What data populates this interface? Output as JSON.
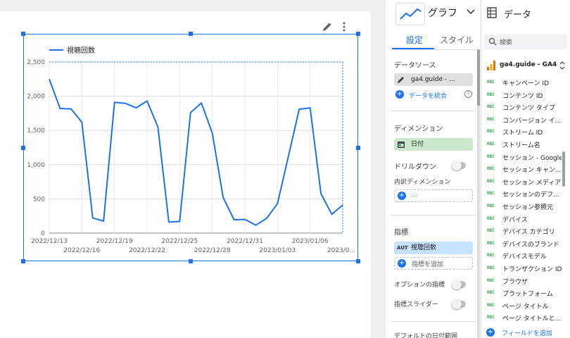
{
  "chart": {
    "legend": "視聴回数",
    "series_color": "#1a73e8"
  },
  "chart_data": {
    "type": "line",
    "series": [
      {
        "name": "視聴回数",
        "values": [
          2250,
          1820,
          1815,
          1620,
          220,
          175,
          1910,
          1895,
          1830,
          1930,
          1550,
          160,
          170,
          1760,
          1900,
          1460,
          520,
          195,
          200,
          115,
          215,
          430,
          1120,
          1810,
          1830,
          575,
          275,
          410
        ]
      }
    ],
    "x": [
      "2022/12/13",
      "2022/12/14",
      "2022/12/15",
      "2022/12/16",
      "2022/12/17",
      "2022/12/18",
      "2022/12/19",
      "2022/12/20",
      "2022/12/21",
      "2022/12/22",
      "2022/12/23",
      "2022/12/24",
      "2022/12/25",
      "2022/12/26",
      "2022/12/27",
      "2022/12/28",
      "2022/12/29",
      "2022/12/30",
      "2022/12/31",
      "2023/01/01",
      "2023/01/02",
      "2023/01/03",
      "2023/01/04",
      "2023/01/05",
      "2023/01/06",
      "2023/01/07",
      "2023/01/08",
      "2023/01/09"
    ],
    "ylim": [
      0,
      2500
    ],
    "yticks": [
      "0",
      "500",
      "1,000",
      "1,500",
      "2,000",
      "2,500"
    ],
    "xticks_top": [
      "2022/12/13",
      "2022/12/19",
      "2022/12/25",
      "2022/12/31",
      "2023/01/06"
    ],
    "xticks_bottom": [
      "2022/12/16",
      "2022/12/22",
      "2022/12/28",
      "2023/01/03",
      "2023/0..."
    ],
    "legend_position": "top-left",
    "grid": true
  },
  "props": {
    "chart_type_label": "グラフ",
    "tab_setup": "設定",
    "tab_style": "スタイル",
    "data_source_title": "データソース",
    "data_source_chip": "ga4.guide - ...",
    "blend_data": "データを統合",
    "dimension_title": "ディメンション",
    "dimension_chip": "日付",
    "drilldown": "ドリルダウン",
    "breakdown_title": "内訳ディメンション",
    "breakdown_placeholder": "...",
    "metric_title": "指標",
    "metric_chip_tag": "AUT",
    "metric_chip": "視聴回数",
    "add_metric": "指標を追加",
    "optional_metrics": "オプションの指標",
    "metric_slider": "指標スライダー",
    "default_date_range": "デフォルトの日付範囲"
  },
  "data_panel": {
    "title": "データ",
    "search_placeholder": "検索",
    "source_name": "ga4.guide - GA4",
    "field_type_tag": "RBC",
    "fields": [
      "キャンペーン ID",
      "コンテンツ ID",
      "コンテンツ タイプ",
      "コンバージョン イ...",
      "ストリーム ID",
      "ストリーム名",
      "セッション - Google...",
      "セッション キャン...",
      "セッション メディア",
      "セッションのデフ...",
      "セッション参照元",
      "デバイス",
      "デバイス カテゴリ",
      "デバイスのブランド",
      "デバイスモデル",
      "トランザクション ID",
      "ブラウザ",
      "プラットフォーム",
      "ページ タイトル",
      "ページ タイトルと..."
    ],
    "add_field": "フィールドを追加"
  },
  "colors": {
    "accent": "#1a73e8",
    "dimension_chip": "#cce8cc",
    "metric_chip": "#c6e2ff",
    "field_tag": "#34a853"
  },
  "icons": [
    "pencil-icon",
    "more-vert-icon",
    "line-chart-icon",
    "chevron-down-icon",
    "table-icon",
    "search-icon",
    "ga4-bar-icon",
    "calendar-icon",
    "plus-icon",
    "help-icon"
  ]
}
